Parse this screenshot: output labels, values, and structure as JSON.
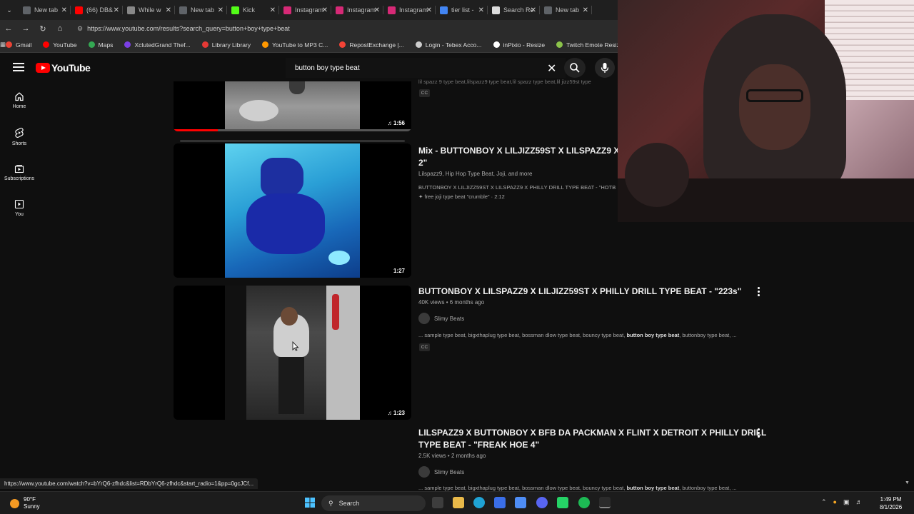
{
  "browser": {
    "tabs": [
      {
        "title": "New tab",
        "icon_color": "#5f6368"
      },
      {
        "title": "(66) DB&",
        "icon_color": "#ff0000"
      },
      {
        "title": "While w",
        "icon_color": "#888888"
      },
      {
        "title": "New tab",
        "icon_color": "#5f6368"
      },
      {
        "title": "Kick",
        "icon_color": "#53fc18"
      },
      {
        "title": "Instagram",
        "icon_color": "#d62976"
      },
      {
        "title": "Instagram",
        "icon_color": "#d62976"
      },
      {
        "title": "Instagram",
        "icon_color": "#d62976"
      },
      {
        "title": "tier list - ",
        "icon_color": "#4285f4"
      },
      {
        "title": "Search Re",
        "icon_color": "#dddddd"
      },
      {
        "title": "New tab",
        "icon_color": "#5f6368"
      }
    ],
    "url": "https://www.youtube.com/results?search_query=button+boy+type+beat",
    "bookmarks": [
      {
        "label": "Gmail",
        "color": "#ea4335"
      },
      {
        "label": "YouTube",
        "color": "#ff0000"
      },
      {
        "label": "Maps",
        "color": "#34a853"
      },
      {
        "label": "XclutedGrand Thef...",
        "color": "#7b3fe4"
      },
      {
        "label": "Library Library",
        "color": "#e53935"
      },
      {
        "label": "YouTube to MP3 C...",
        "color": "#ff9800"
      },
      {
        "label": "RepostExchange |...",
        "color": "#f44336"
      },
      {
        "label": "Login - Tebex Acco...",
        "color": "#cccccc"
      },
      {
        "label": "inPixio - Resize",
        "color": "#ffffff"
      },
      {
        "label": "Twitch Emote Resiz...",
        "color": "#8bc34a"
      }
    ]
  },
  "youtube": {
    "logo_text": "YouTube",
    "search_query": "button boy type beat",
    "sidebar": [
      {
        "label": "Home"
      },
      {
        "label": "Shorts"
      },
      {
        "label": "Subscriptions"
      },
      {
        "label": "You"
      }
    ],
    "results": [
      {
        "duration": "1:56",
        "snippet_top": "lil spazz 9 type beat,lilspazz9 type beat,lil spazz type beat,lil jizz59st type",
        "cc": "CC"
      },
      {
        "duration": "1:27",
        "title_line1": "Mix - BUTTONBOY X LILJIZZ59ST X LILSPAZZ9 X PH",
        "title_line2": "2\"",
        "channels": "Lilspazz9, Hip Hop Type Beat, Joji, and more",
        "desc1": "BUTTONBOY X LILJIZZ59ST X LILSPAZZ9 X PHILLY DRILL TYPE BEAT - \"HOTB",
        "desc2": "✦ free joji type beat \"crumble\" · 2:12"
      },
      {
        "duration": "1:23",
        "title": "BUTTONBOY X LILSPAZZ9 X LILJIZZ59ST X PHILLY DRILL TYPE BEAT - \"223s\"",
        "views": "40K views",
        "age": "6 months ago",
        "channel": "Slimy Beats",
        "desc_pre": "... sample type beat, bigxthaplug type beat, bossman dlow type beat, bouncy type beat, ",
        "desc_bold": "button boy type beat",
        "desc_post": ", buttonboy type beat, ...",
        "cc": "CC"
      },
      {
        "title_line1": "LILSPAZZ9 X BUTTONBOY X BFB DA PACKMAN X FLINT X DETROIT X PHILLY DRILL",
        "title_line2": "TYPE BEAT - \"FREAK HOE 4\"",
        "views": "2.5K views",
        "age": "2 months ago",
        "channel": "Slimy Beats",
        "desc_pre": "... sample type beat, bigxthaplug type beat, bossman dlow type beat, bouncy type beat, ",
        "desc_bold": "button boy type beat",
        "desc_post": ", buttonboy type beat, ..."
      }
    ],
    "hover_link": "https://www.youtube.com/watch?v=bYrQ6-zfhdc&list=RDbYrQ6-zfhdc&start_radio=1&pp=0gcJCf..."
  },
  "taskbar": {
    "weather_temp": "90°F",
    "weather_desc": "Sunny",
    "search_label": "Search",
    "time": "1:49 PM",
    "date": "8/1/2026"
  }
}
